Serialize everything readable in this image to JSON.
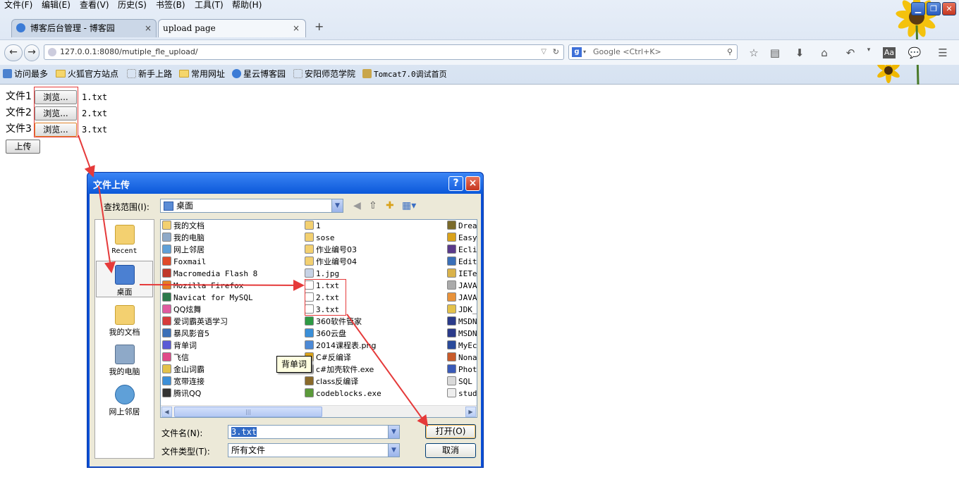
{
  "menubar": {
    "items": [
      "文件(F)",
      "编辑(E)",
      "查看(V)",
      "历史(S)",
      "书签(B)",
      "工具(T)",
      "帮助(H)"
    ]
  },
  "tabs": [
    {
      "label": "博客后台管理 - 博客园",
      "close": "×"
    },
    {
      "label": "upload page",
      "close": "×"
    }
  ],
  "new_tab": "+",
  "navbar": {
    "url": "127.0.0.1:8080/mutiple_fle_upload/",
    "search_placeholder": "Google <Ctrl+K>"
  },
  "bookmarks": [
    "访问最多",
    "火狐官方站点",
    "新手上路",
    "常用网址",
    "星云博客园",
    "安阳师范学院",
    "Tomcat7.0调试首页"
  ],
  "form": {
    "rows": [
      {
        "label": "文件1",
        "button": "浏览...",
        "file": "1.txt"
      },
      {
        "label": "文件2",
        "button": "浏览...",
        "file": "2.txt"
      },
      {
        "label": "文件3",
        "button": "浏览...",
        "file": "3.txt"
      }
    ],
    "upload_button": "上传"
  },
  "dialog": {
    "title": "文件上传",
    "help": "?",
    "close": "×",
    "lookin_label": "查找范围(I):",
    "lookin_value": "桌面",
    "places": [
      "Recent",
      "桌面",
      "我的文档",
      "我的电脑",
      "网上邻居"
    ],
    "columns": [
      [
        "我的文档",
        "我的电脑",
        "网上邻居",
        "Foxmail",
        "Macromedia Flash 8",
        "Mozilla Firefox",
        "Navicat for MySQL",
        "QQ炫舞",
        "爱词霸英语学习",
        "暴风影音5",
        "背单词",
        "飞信",
        "金山词霸",
        "宽带连接",
        "腾讯QQ"
      ],
      [
        "1",
        "sose",
        "作业编号03",
        "作业编号04",
        "1.jpg",
        "1.txt",
        "2.txt",
        "3.txt",
        "360软件管家",
        "360云盘",
        "2014课程表.png",
        "C#反编译",
        "c#加壳软件.exe",
        "class反编译",
        "codeblocks.exe"
      ],
      [
        "Drea",
        "Easy",
        "Ecli",
        "Edit",
        "IETe",
        "JAVA",
        "JAVA",
        "JDK_",
        "MSDN",
        "MSDN",
        "MyEc",
        "Nona",
        "Phot",
        "SQL",
        "stud"
      ]
    ],
    "filename_label": "文件名(N):",
    "filename_value": "3.txt",
    "filetype_label": "文件类型(T):",
    "filetype_value": "所有文件",
    "open_button": "打开(O)",
    "cancel_button": "取消",
    "tooltip": "背单词"
  }
}
